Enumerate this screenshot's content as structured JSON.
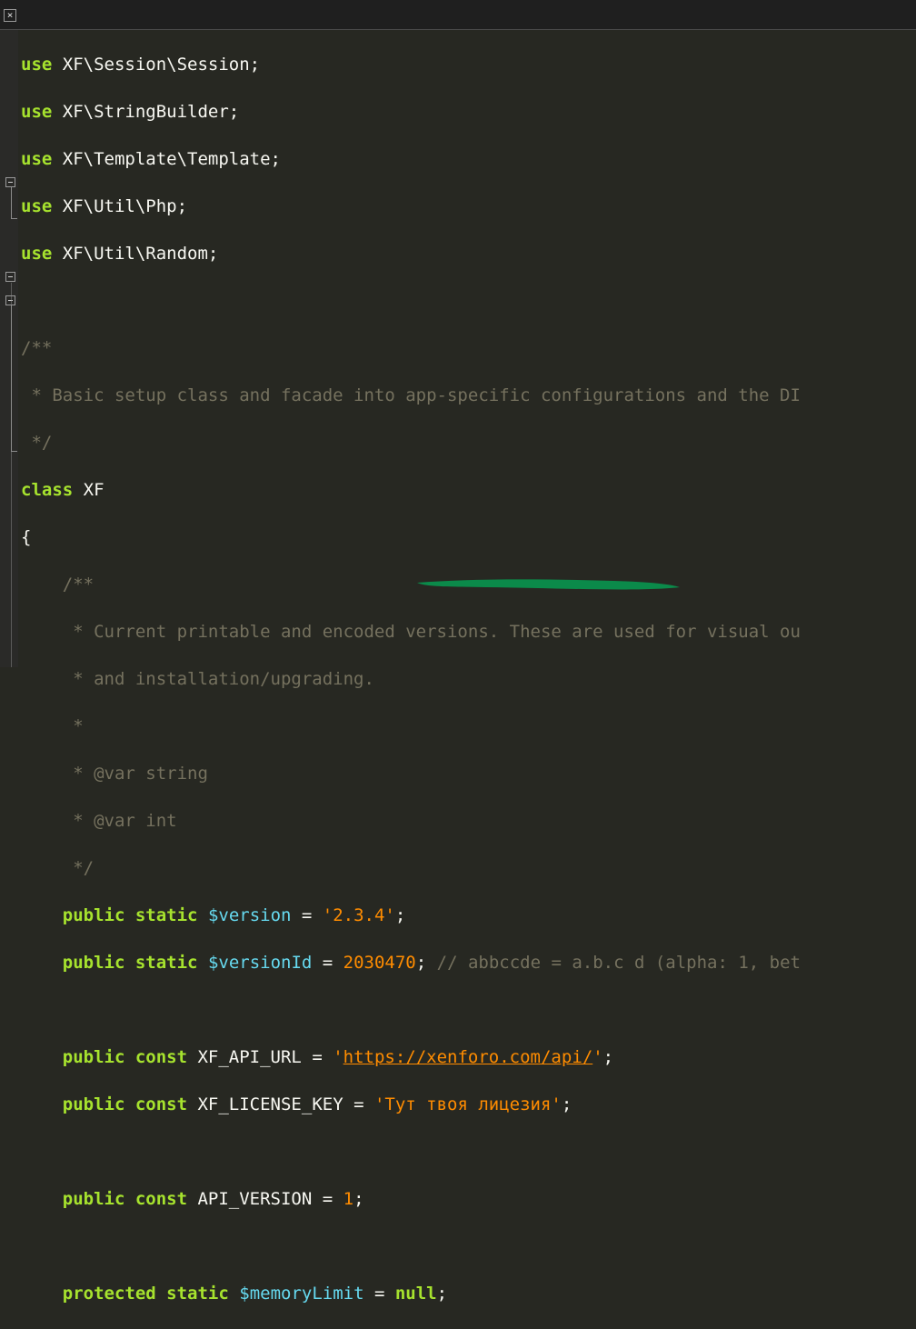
{
  "tab": {
    "close_glyph": "×"
  },
  "code": {
    "line_use_1": {
      "kw": "use",
      "text": " XF\\Session\\Session;"
    },
    "line_use_2": {
      "kw": "use",
      "text": " XF\\StringBuilder;"
    },
    "line_use_3": {
      "kw": "use",
      "text": " XF\\Template\\Template;"
    },
    "line_use_4": {
      "kw": "use",
      "text": " XF\\Util\\Php;"
    },
    "line_use_5": {
      "kw": "use",
      "text": " XF\\Util\\Random;"
    },
    "doc1_open": "/**",
    "doc1_text": " * Basic setup class and facade into app-specific configurations and the DI",
    "doc1_close": " */",
    "class_kw": "class",
    "class_name": " XF",
    "brace_open": "{",
    "doc2_open": "    /**",
    "doc2_line1": "     * Current printable and encoded versions. These are used for visual ou",
    "doc2_line2": "     * and installation/upgrading.",
    "doc2_line3": "     *",
    "doc2_line4": "     * @var string",
    "doc2_line5": "     * @var int",
    "doc2_close": "     */",
    "version": {
      "indent": "    ",
      "kw": "public static",
      "var": "$version",
      "op": " = ",
      "val": "'2.3.4'",
      "end": ";"
    },
    "version_id": {
      "indent": "    ",
      "kw": "public static",
      "var": "$versionId",
      "op": " = ",
      "val": "2030470",
      "end": ";",
      "comment": " // abbccde = a.b.c d (alpha: 1, bet"
    },
    "api_url": {
      "indent": "    ",
      "kw": "public const",
      "name": " XF_API_URL = ",
      "q1": "'",
      "url": "https://xenforo.com/api/",
      "q2": "'",
      "end": ";"
    },
    "license_key": {
      "indent": "    ",
      "kw": "public const",
      "name": " XF_LICENSE_KEY = ",
      "val": "'Тут твоя лицезия'",
      "end": ";"
    },
    "api_version": {
      "indent": "    ",
      "kw": "public const",
      "name": " API_VERSION = ",
      "val": "1",
      "end": ";"
    },
    "memory_limit": {
      "indent": "    ",
      "kw": "protected static",
      "var": "$memoryLimit",
      "op": " = ",
      "val_kw": "null",
      "end": ";"
    }
  },
  "colors": {
    "background": "#272822",
    "keyword": "#a6e22e",
    "variable": "#66d9ef",
    "string": "#ff8c00",
    "comment": "#75715e",
    "highlighter_marker": "#0b8a4a"
  }
}
